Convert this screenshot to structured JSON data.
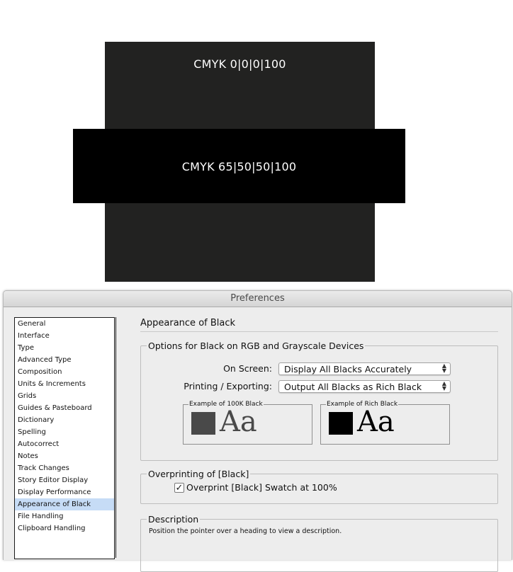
{
  "illustration": {
    "top_label": "CMYK 0|0|0|100",
    "middle_label": "CMYK 65|50|50|100"
  },
  "window": {
    "title": "Preferences"
  },
  "sidebar": {
    "items": [
      {
        "label": "General"
      },
      {
        "label": "Interface"
      },
      {
        "label": "Type"
      },
      {
        "label": "Advanced Type"
      },
      {
        "label": "Composition"
      },
      {
        "label": "Units & Increments"
      },
      {
        "label": "Grids"
      },
      {
        "label": "Guides & Pasteboard"
      },
      {
        "label": "Dictionary"
      },
      {
        "label": "Spelling"
      },
      {
        "label": "Autocorrect"
      },
      {
        "label": "Notes"
      },
      {
        "label": "Track Changes"
      },
      {
        "label": "Story Editor Display"
      },
      {
        "label": "Display Performance"
      },
      {
        "label": "Appearance of Black",
        "selected": true
      },
      {
        "label": "File Handling"
      },
      {
        "label": "Clipboard Handling"
      }
    ]
  },
  "panel": {
    "title": "Appearance of Black",
    "options_group": {
      "legend": "Options for Black on RGB and Grayscale Devices",
      "on_screen_label": "On Screen:",
      "on_screen_value": "Display All Blacks Accurately",
      "printing_label": "Printing / Exporting:",
      "printing_value": "Output All Blacks as Rich Black",
      "example_100k_legend": "Example of 100K Black",
      "example_rich_legend": "Example of Rich Black",
      "example_text": "Aa"
    },
    "overprint_group": {
      "legend": "Overprinting of [Black]",
      "checkbox_label": "Overprint [Black] Swatch at 100%",
      "checked": true
    },
    "description_group": {
      "legend": "Description",
      "text": "Position the pointer over a heading to view a description."
    }
  },
  "colors": {
    "black_100k": "#222221",
    "rich_black": "#000000",
    "selection": "#c6dcf6"
  }
}
